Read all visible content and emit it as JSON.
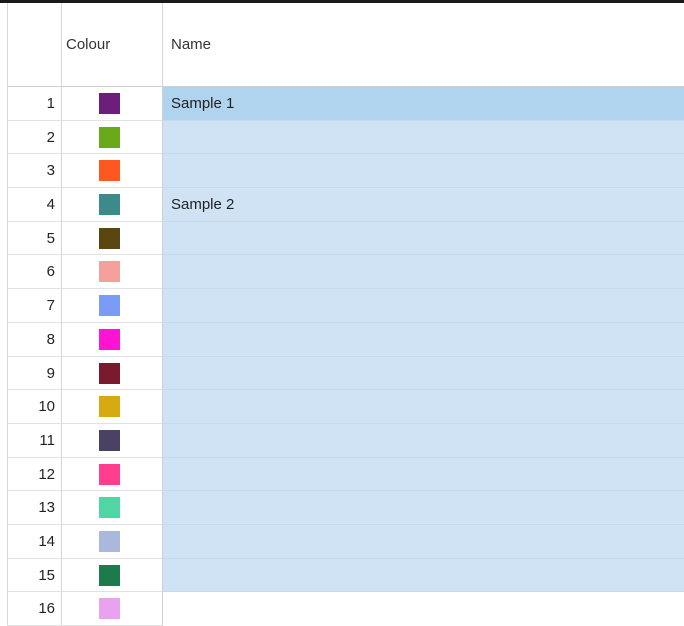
{
  "columns": {
    "corner": "",
    "colour": "Colour",
    "name": "Name"
  },
  "rows": [
    {
      "index": "1",
      "color": "#6b1e7a",
      "name": "Sample 1",
      "state": "selected"
    },
    {
      "index": "2",
      "color": "#6aaa1a",
      "name": "",
      "state": "highlighted"
    },
    {
      "index": "3",
      "color": "#ff5722",
      "name": "",
      "state": "highlighted"
    },
    {
      "index": "4",
      "color": "#3d8a8a",
      "name": "Sample 2",
      "state": "highlighted"
    },
    {
      "index": "5",
      "color": "#5a4610",
      "name": "",
      "state": "highlighted"
    },
    {
      "index": "6",
      "color": "#f4a09c",
      "name": "",
      "state": "highlighted"
    },
    {
      "index": "7",
      "color": "#7b9cf4",
      "name": "",
      "state": "highlighted"
    },
    {
      "index": "8",
      "color": "#ff14d2",
      "name": "",
      "state": "highlighted"
    },
    {
      "index": "9",
      "color": "#7a1a2e",
      "name": "",
      "state": "highlighted"
    },
    {
      "index": "10",
      "color": "#d8aa12",
      "name": "",
      "state": "highlighted"
    },
    {
      "index": "11",
      "color": "#4a4262",
      "name": "",
      "state": "highlighted"
    },
    {
      "index": "12",
      "color": "#ff3f8e",
      "name": "",
      "state": "highlighted"
    },
    {
      "index": "13",
      "color": "#4fd6a4",
      "name": "",
      "state": "highlighted"
    },
    {
      "index": "14",
      "color": "#aab8dc",
      "name": "",
      "state": "highlighted"
    },
    {
      "index": "15",
      "color": "#1d7a4a",
      "name": "",
      "state": "highlighted"
    },
    {
      "index": "16",
      "color": "#e8a2ee",
      "name": "",
      "state": "blank"
    }
  ]
}
